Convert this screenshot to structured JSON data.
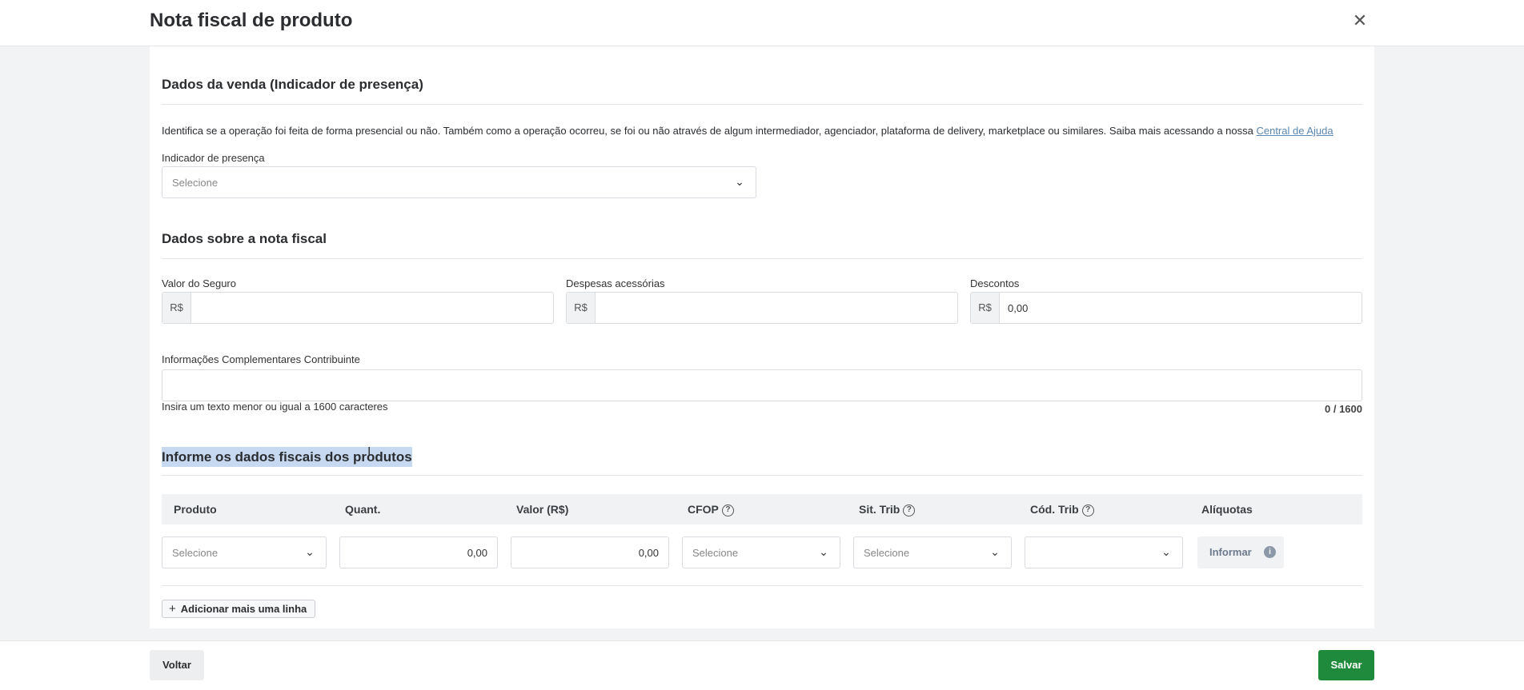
{
  "header": {
    "title": "Nota fiscal de produto",
    "close_icon": "close-icon"
  },
  "venda": {
    "title": "Dados da venda (Indicador de presença)",
    "description": "Identifica se a operação foi feita de forma presencial ou não. Também como a operação ocorreu, se foi ou não através de algum intermediador, agenciador, plataforma de delivery, marketplace ou similares. Saiba mais acessando a nossa ",
    "link": "Central de Ajuda",
    "indicador_label": "Indicador de presença",
    "indicador_placeholder": "Selecione"
  },
  "nota": {
    "title": "Dados sobre a nota fiscal",
    "seguro": {
      "label": "Valor do Seguro",
      "prefix": "R$",
      "value": ""
    },
    "despesas": {
      "label": "Despesas acessórias",
      "prefix": "R$",
      "value": ""
    },
    "descontos": {
      "label": "Descontos",
      "prefix": "R$",
      "value": "0,00"
    },
    "info_label": "Informações Complementares Contribuinte",
    "info_hint": "Insira um texto menor ou igual a 1600 caracteres",
    "info_counter": "0 / 1600"
  },
  "produtos": {
    "title": "Informe os dados fiscais dos produtos",
    "columns": [
      "Produto",
      "Quant.",
      "Valor (R$)",
      "CFOP",
      "Sit. Trib",
      "Cód. Trib",
      "Alíquotas"
    ],
    "row": {
      "produto": "Selecione",
      "quant": "0,00",
      "valor": "0,00",
      "cfop": "Selecione",
      "sit_trib": "Selecione",
      "cod_trib": "",
      "aliquotas_button": "Informar"
    },
    "add_line": "Adicionar mais uma linha"
  },
  "footer": {
    "back": "Voltar",
    "save": "Salvar"
  },
  "colors": {
    "save": "#1f8a3b",
    "link": "#5b86b0",
    "highlight": "#c6d9f0"
  }
}
